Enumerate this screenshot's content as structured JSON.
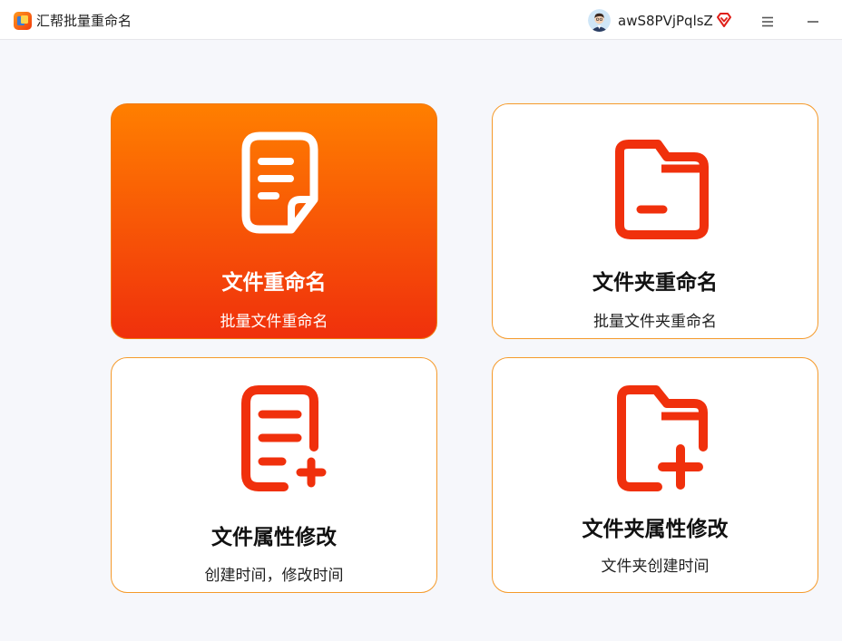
{
  "app": {
    "title": "汇帮批量重命名"
  },
  "user": {
    "name": "awS8PVjPqlsZ"
  },
  "colors": {
    "accent_start": "#ff7f00",
    "accent_end": "#f0300c",
    "icon_red": "#f0300c",
    "card_border": "#f59a2a"
  },
  "cards": [
    {
      "title": "文件重命名",
      "subtitle": "批量文件重命名",
      "icon": "document-icon",
      "active": true
    },
    {
      "title": "文件夹重命名",
      "subtitle": "批量文件夹重命名",
      "icon": "folder-icon",
      "active": false
    },
    {
      "title": "文件属性修改",
      "subtitle": "创建时间，修改时间",
      "icon": "document-add-icon",
      "active": false
    },
    {
      "title": "文件夹属性修改",
      "subtitle": "文件夹创建时间",
      "icon": "folder-add-icon",
      "active": false
    }
  ]
}
